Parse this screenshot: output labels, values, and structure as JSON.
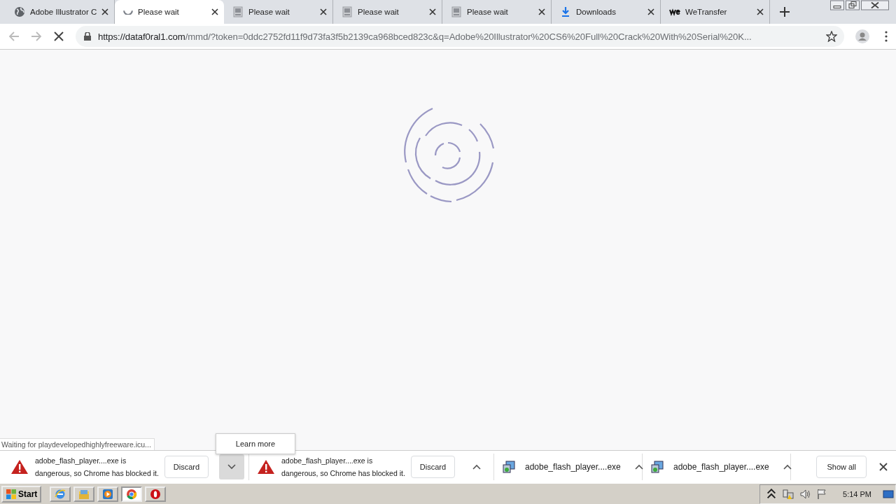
{
  "tabs": [
    {
      "title": "Adobe Illustrator C",
      "selected": false
    },
    {
      "title": "Please wait",
      "selected": true
    },
    {
      "title": "Please wait",
      "selected": false
    },
    {
      "title": "Please wait",
      "selected": false
    },
    {
      "title": "Please wait",
      "selected": false
    },
    {
      "title": "Downloads",
      "selected": false
    },
    {
      "title": "WeTransfer",
      "selected": false
    }
  ],
  "address": {
    "host": "https://dataf0ral1.com",
    "path": "/mmd/?token=0ddc2752fd11f9d73fa3f5b2139ca968bced823c&q=Adobe%20Illustrator%20CS6%20Full%20Crack%20With%20Serial%20K..."
  },
  "status_text": "Waiting for playdevelopedhighlyfreeware.icu...",
  "menu": {
    "item": "Learn more"
  },
  "downloads": [
    {
      "kind": "blocked",
      "line_1": "adobe_flash_player....exe is",
      "line_2": "dangerous, so Chrome has blocked it.",
      "button": "Discard",
      "menu_open": true
    },
    {
      "kind": "blocked",
      "line_1": "adobe_flash_player....exe is",
      "line_2": "dangerous, so Chrome has blocked it.",
      "button": "Discard",
      "menu_open": false
    },
    {
      "kind": "file",
      "name": "adobe_flash_player....exe",
      "menu_open": false
    },
    {
      "kind": "file",
      "name": "adobe_flash_player....exe",
      "menu_open": false
    }
  ],
  "show_all": "Show all",
  "taskbar": {
    "start": "Start",
    "apps": [
      {
        "selected": false
      },
      {
        "selected": false
      },
      {
        "selected": false
      },
      {
        "selected": true
      },
      {
        "selected": false
      }
    ],
    "clock": "5:14 PM"
  }
}
